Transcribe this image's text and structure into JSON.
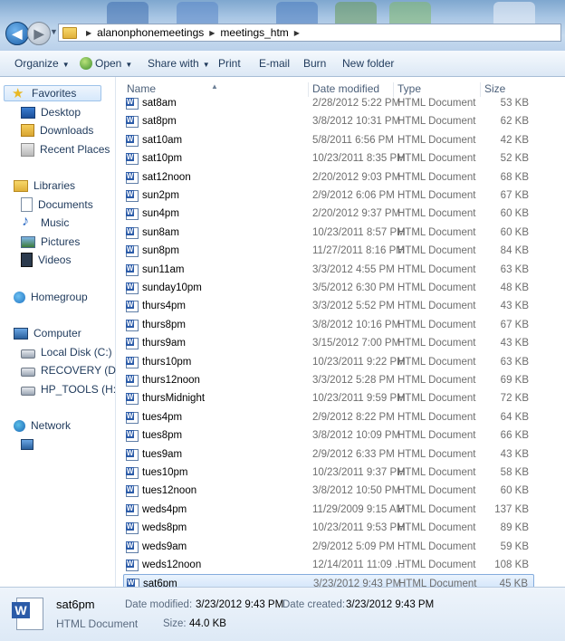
{
  "address": {
    "crumbs": [
      "alanonphonemeetings",
      "meetings_htm"
    ]
  },
  "toolbar": {
    "organize": "Organize",
    "open": "Open",
    "share": "Share with",
    "print": "Print",
    "email": "E-mail",
    "burn": "Burn",
    "new_folder": "New folder"
  },
  "sidebar": {
    "favorites": "Favorites",
    "desktop": "Desktop",
    "downloads": "Downloads",
    "recent": "Recent Places",
    "libraries": "Libraries",
    "documents": "Documents",
    "music": "Music",
    "pictures": "Pictures",
    "videos": "Videos",
    "homegroup": "Homegroup",
    "computer": "Computer",
    "local_disk": "Local Disk (C:)",
    "recovery": "RECOVERY (D:)",
    "hp_tools": "HP_TOOLS (H:)",
    "network": "Network"
  },
  "columns": {
    "name": "Name",
    "date": "Date modified",
    "type": "Type",
    "size": "Size"
  },
  "files": [
    {
      "name": "sat8am",
      "date": "2/28/2012 5:22 PM",
      "type": "HTML Document",
      "size": "53 KB"
    },
    {
      "name": "sat8pm",
      "date": "3/8/2012 10:31 PM",
      "type": "HTML Document",
      "size": "62 KB"
    },
    {
      "name": "sat10am",
      "date": "5/8/2011 6:56 PM",
      "type": "HTML Document",
      "size": "42 KB"
    },
    {
      "name": "sat10pm",
      "date": "10/23/2011 8:35 PM",
      "type": "HTML Document",
      "size": "52 KB"
    },
    {
      "name": "sat12noon",
      "date": "2/20/2012 9:03 PM",
      "type": "HTML Document",
      "size": "68 KB"
    },
    {
      "name": "sun2pm",
      "date": "2/9/2012 6:06 PM",
      "type": "HTML Document",
      "size": "67 KB"
    },
    {
      "name": "sun4pm",
      "date": "2/20/2012 9:37 PM",
      "type": "HTML Document",
      "size": "60 KB"
    },
    {
      "name": "sun8am",
      "date": "10/23/2011 8:57 PM",
      "type": "HTML Document",
      "size": "60 KB"
    },
    {
      "name": "sun8pm",
      "date": "11/27/2011 8:16 PM",
      "type": "HTML Document",
      "size": "84 KB"
    },
    {
      "name": "sun11am",
      "date": "3/3/2012 4:55 PM",
      "type": "HTML Document",
      "size": "63 KB"
    },
    {
      "name": "sunday10pm",
      "date": "3/5/2012 6:30 PM",
      "type": "HTML Document",
      "size": "48 KB"
    },
    {
      "name": "thurs4pm",
      "date": "3/3/2012 5:52 PM",
      "type": "HTML Document",
      "size": "43 KB"
    },
    {
      "name": "thurs8pm",
      "date": "3/8/2012 10:16 PM",
      "type": "HTML Document",
      "size": "67 KB"
    },
    {
      "name": "thurs9am",
      "date": "3/15/2012 7:00 PM",
      "type": "HTML Document",
      "size": "43 KB"
    },
    {
      "name": "thurs10pm",
      "date": "10/23/2011 9:22 PM",
      "type": "HTML Document",
      "size": "63 KB"
    },
    {
      "name": "thurs12noon",
      "date": "3/3/2012 5:28 PM",
      "type": "HTML Document",
      "size": "69 KB"
    },
    {
      "name": "thursMidnight",
      "date": "10/23/2011 9:59 PM",
      "type": "HTML Document",
      "size": "72 KB"
    },
    {
      "name": "tues4pm",
      "date": "2/9/2012 8:22 PM",
      "type": "HTML Document",
      "size": "64 KB"
    },
    {
      "name": "tues8pm",
      "date": "3/8/2012 10:09 PM",
      "type": "HTML Document",
      "size": "66 KB"
    },
    {
      "name": "tues9am",
      "date": "2/9/2012 6:33 PM",
      "type": "HTML Document",
      "size": "43 KB"
    },
    {
      "name": "tues10pm",
      "date": "10/23/2011 9:37 PM",
      "type": "HTML Document",
      "size": "58 KB"
    },
    {
      "name": "tues12noon",
      "date": "3/8/2012 10:50 PM",
      "type": "HTML Document",
      "size": "60 KB"
    },
    {
      "name": "weds4pm",
      "date": "11/29/2009 9:15 AM",
      "type": "HTML Document",
      "size": "137 KB"
    },
    {
      "name": "weds8pm",
      "date": "10/23/2011 9:53 PM",
      "type": "HTML Document",
      "size": "89 KB"
    },
    {
      "name": "weds9am",
      "date": "2/9/2012 5:09 PM",
      "type": "HTML Document",
      "size": "59 KB"
    },
    {
      "name": "weds12noon",
      "date": "12/14/2011 11:09 ...",
      "type": "HTML Document",
      "size": "108 KB"
    },
    {
      "name": "sat6pm",
      "date": "3/23/2012 9:43 PM",
      "type": "HTML Document",
      "size": "45 KB",
      "selected": true
    }
  ],
  "details": {
    "name": "sat6pm",
    "type": "HTML Document",
    "modified_label": "Date modified:",
    "modified": "3/23/2012 9:43 PM",
    "created_label": "Date created:",
    "created": "3/23/2012 9:43 PM",
    "size_label": "Size:",
    "size": "44.0 KB"
  }
}
